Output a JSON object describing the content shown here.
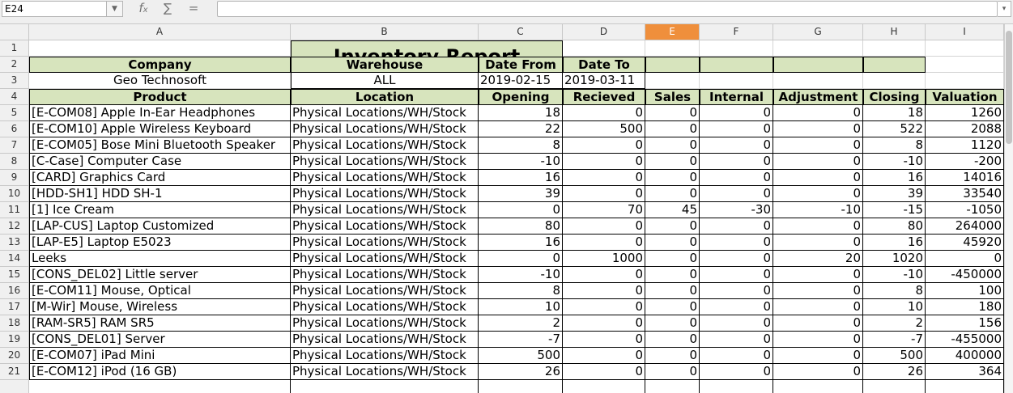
{
  "formula_bar": {
    "cell_ref": "E24",
    "fx_icon": "function-icon",
    "sum_icon": "sum-icon",
    "equals_icon": "equals-icon",
    "formula": ""
  },
  "columns": [
    "A",
    "B",
    "C",
    "D",
    "E",
    "F",
    "G",
    "H",
    "I"
  ],
  "active_column": "E",
  "rows": [
    "1",
    "2",
    "3",
    "4",
    "5",
    "6",
    "7",
    "8",
    "9",
    "10",
    "11",
    "12",
    "13",
    "14",
    "15",
    "16",
    "17",
    "18",
    "19",
    "20",
    "21"
  ],
  "report": {
    "title": "Inventory Report",
    "company_label": "Company",
    "warehouse_label": "Warehouse",
    "date_from_label": "Date From",
    "date_to_label": "Date To",
    "company": "Geo Technosoft",
    "warehouse": "ALL",
    "date_from": "2019-02-15",
    "date_to": "2019-03-11"
  },
  "table": {
    "headers": [
      "Product",
      "Location",
      "Opening",
      "Recieved",
      "Sales",
      "Internal",
      "Adjustment",
      "Closing",
      "Valuation"
    ],
    "rows": [
      [
        "[E-COM08] Apple In-Ear Headphones",
        "Physical Locations/WH/Stock",
        "18",
        "0",
        "0",
        "0",
        "0",
        "18",
        "1260"
      ],
      [
        "[E-COM10] Apple Wireless Keyboard",
        "Physical Locations/WH/Stock",
        "22",
        "500",
        "0",
        "0",
        "0",
        "522",
        "2088"
      ],
      [
        "[E-COM05] Bose Mini Bluetooth Speaker",
        "Physical Locations/WH/Stock",
        "8",
        "0",
        "0",
        "0",
        "0",
        "8",
        "1120"
      ],
      [
        "[C-Case] Computer Case",
        "Physical Locations/WH/Stock",
        "-10",
        "0",
        "0",
        "0",
        "0",
        "-10",
        "-200"
      ],
      [
        "[CARD] Graphics Card",
        "Physical Locations/WH/Stock",
        "16",
        "0",
        "0",
        "0",
        "0",
        "16",
        "14016"
      ],
      [
        "[HDD-SH1] HDD SH-1",
        "Physical Locations/WH/Stock",
        "39",
        "0",
        "0",
        "0",
        "0",
        "39",
        "33540"
      ],
      [
        "[1] Ice Cream",
        "Physical Locations/WH/Stock",
        "0",
        "70",
        "45",
        "-30",
        "-10",
        "-15",
        "-1050"
      ],
      [
        "[LAP-CUS] Laptop Customized",
        "Physical Locations/WH/Stock",
        "80",
        "0",
        "0",
        "0",
        "0",
        "80",
        "264000"
      ],
      [
        "[LAP-E5] Laptop E5023",
        "Physical Locations/WH/Stock",
        "16",
        "0",
        "0",
        "0",
        "0",
        "16",
        "45920"
      ],
      [
        "Leeks",
        "Physical Locations/WH/Stock",
        "0",
        "1000",
        "0",
        "0",
        "20",
        "1020",
        "0"
      ],
      [
        "[CONS_DEL02] Little server",
        "Physical Locations/WH/Stock",
        "-10",
        "0",
        "0",
        "0",
        "0",
        "-10",
        "-450000"
      ],
      [
        "[E-COM11] Mouse, Optical",
        "Physical Locations/WH/Stock",
        "8",
        "0",
        "0",
        "0",
        "0",
        "8",
        "100"
      ],
      [
        "[M-Wir] Mouse, Wireless",
        "Physical Locations/WH/Stock",
        "10",
        "0",
        "0",
        "0",
        "0",
        "10",
        "180"
      ],
      [
        "[RAM-SR5] RAM SR5",
        "Physical Locations/WH/Stock",
        "2",
        "0",
        "0",
        "0",
        "0",
        "2",
        "156"
      ],
      [
        "[CONS_DEL01] Server",
        "Physical Locations/WH/Stock",
        "-7",
        "0",
        "0",
        "0",
        "0",
        "-7",
        "-455000"
      ],
      [
        "[E-COM07] iPad Mini",
        "Physical Locations/WH/Stock",
        "500",
        "0",
        "0",
        "0",
        "0",
        "500",
        "400000"
      ],
      [
        "[E-COM12] iPod (16 GB)",
        "Physical Locations/WH/Stock",
        "26",
        "0",
        "0",
        "0",
        "0",
        "26",
        "364"
      ]
    ]
  },
  "colors": {
    "header_fill": "#d7e4bd",
    "active_column": "#ef8f3c"
  }
}
